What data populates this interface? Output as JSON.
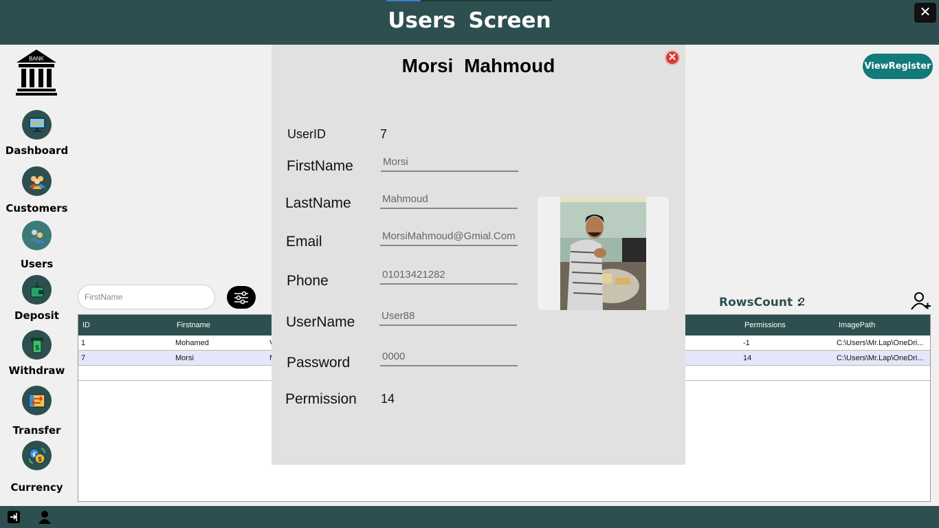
{
  "window": {
    "title": "Users  Screen",
    "close_glyph": "✕"
  },
  "sidebar": {
    "logo_text": "BANK",
    "items": [
      {
        "label": "Dashboard",
        "icon": "dashboard-monitor-icon"
      },
      {
        "label": "Customers",
        "icon": "customers-group-icon"
      },
      {
        "label": "Users",
        "icon": "users-icon",
        "active": true
      },
      {
        "label": "Deposit",
        "icon": "deposit-wallet-icon"
      },
      {
        "label": "Withdraw",
        "icon": "withdraw-atm-icon"
      },
      {
        "label": "Transfer",
        "icon": "transfer-arrows-icon"
      },
      {
        "label": "Currency",
        "icon": "currency-exchange-icon"
      }
    ]
  },
  "footer": {
    "icons": [
      "logout-icon",
      "user-profile-icon"
    ]
  },
  "toolbar": {
    "view_register_label": "ViewRegister",
    "search_placeholder": "FirstName",
    "rows_count_label": "RowsCount :",
    "rows_count_value": "2"
  },
  "grid": {
    "columns": [
      "ID",
      "Firstname",
      "Permissions",
      "ImagePath"
    ],
    "rows": [
      {
        "id": "1",
        "firstname": "Mohamed",
        "partial": "V",
        "permissions": "-1",
        "imagepath": "C:\\Users\\Mr.Lap\\OneDri..."
      },
      {
        "id": "7",
        "firstname": "Morsi",
        "partial": "M",
        "permissions": "14",
        "imagepath": "C:\\Users\\Mr.Lap\\OneDri...",
        "selected": true
      }
    ]
  },
  "modal": {
    "title": "Morsi  Mahmoud",
    "close_glyph": "✕",
    "user_id_label": "UserID",
    "user_id_value": "7",
    "first_name_label": "FirstName",
    "first_name_value": "Morsi",
    "last_name_label": "LastName",
    "last_name_value": "Mahmoud",
    "email_label": "Email",
    "email_value": "MorsiMahmoud@Gmial.Com",
    "phone_label": "Phone",
    "phone_value": "01013421282",
    "username_label": "UserName",
    "username_value": "User88",
    "password_label": "Password",
    "password_value": "0000",
    "permission_label": "Permission",
    "permission_value": "14"
  },
  "colors": {
    "primary_dark": "#2e4f4f",
    "accent_teal": "#127a78",
    "selected_row": "#e6e6fa",
    "close_red": "#d73a32"
  }
}
